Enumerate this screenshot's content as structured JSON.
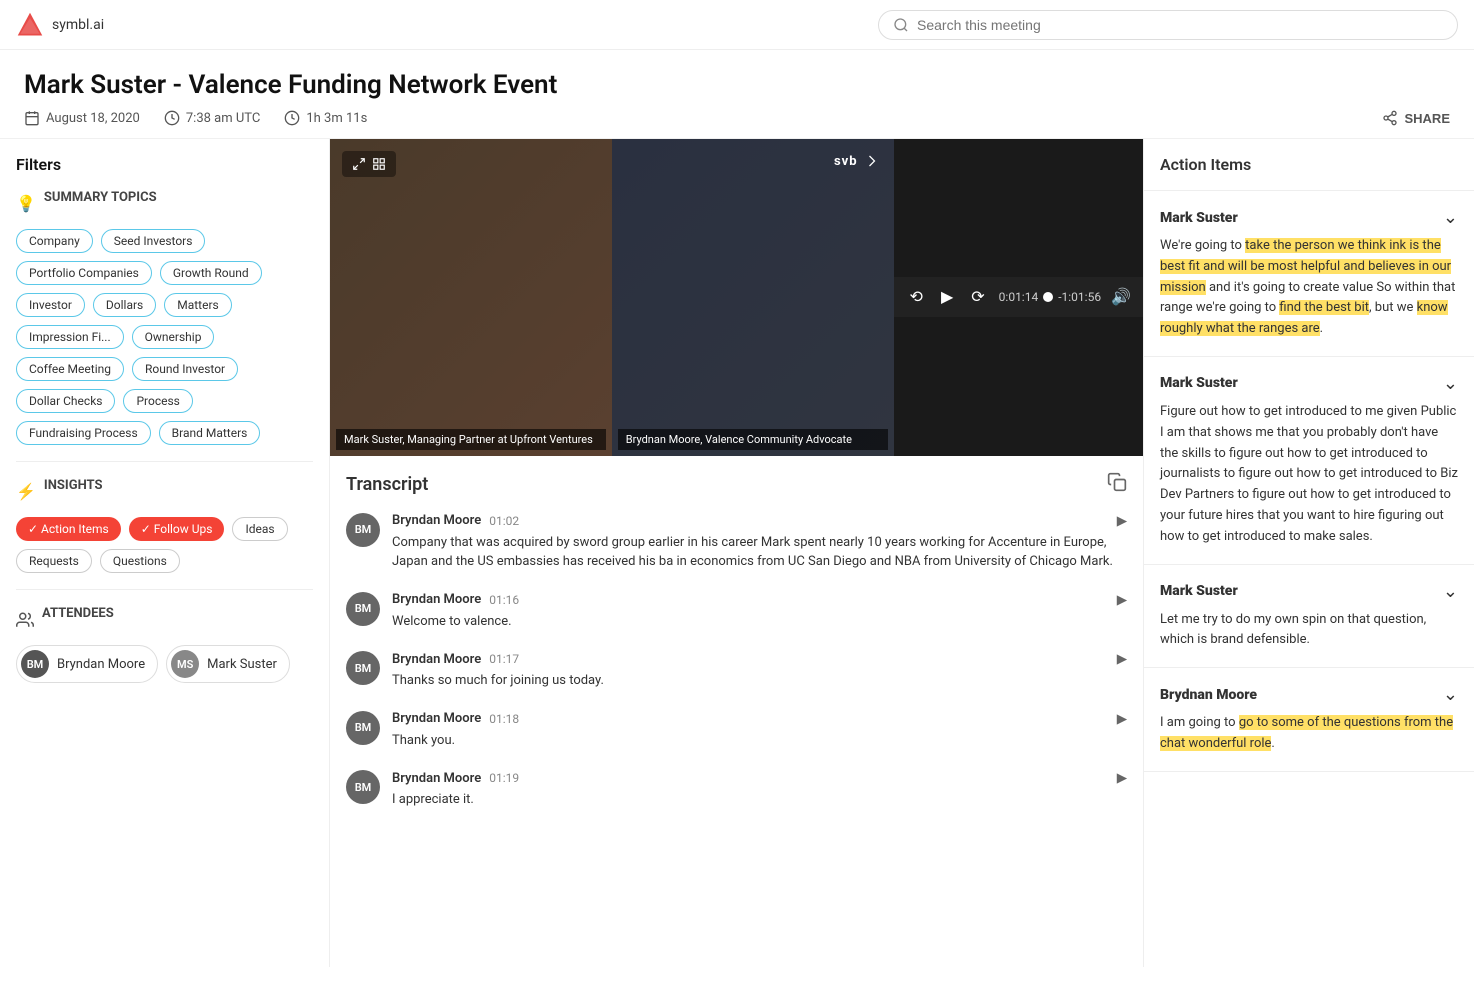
{
  "app": {
    "name": "symbl.ai"
  },
  "header": {
    "search_placeholder": "Search this meeting",
    "title": "Mark Suster - Valence Funding Network Event",
    "date": "August 18, 2020",
    "time": "7:38 am UTC",
    "duration": "1h 3m 11s",
    "share_label": "SHARE"
  },
  "filters": {
    "heading": "Filters",
    "summary_topics_label": "SUMMARY TOPICS",
    "tags": [
      "Company",
      "Seed Investors",
      "Portfolio Companies",
      "Growth Round",
      "Investor",
      "Dollars",
      "Matters",
      "Impression Fi...",
      "Ownership",
      "Coffee Meeting",
      "Round Investor",
      "Dollar Checks",
      "Process",
      "Fundraising Process",
      "Brand Matters"
    ]
  },
  "insights": {
    "label": "INSIGHTS",
    "tags": [
      {
        "label": "Action Items",
        "active": true,
        "color": "red"
      },
      {
        "label": "Follow Ups",
        "active": true,
        "color": "red"
      },
      {
        "label": "Ideas",
        "active": false
      },
      {
        "label": "Requests",
        "active": false
      },
      {
        "label": "Questions",
        "active": false
      }
    ]
  },
  "attendees": {
    "label": "ATTENDEES",
    "list": [
      {
        "initials": "BM",
        "name": "Bryndan Moore",
        "type": "bm"
      },
      {
        "initials": "MS",
        "name": "Mark Suster",
        "type": "ms"
      }
    ]
  },
  "video": {
    "left_label": "Mark Suster, Managing Partner at Upfront Ventures",
    "right_label": "Brydnan Moore, Valence Community Advocate",
    "current_time": "0:01:14",
    "remaining_time": "-1:01:56",
    "progress_percent": 1.9
  },
  "transcript": {
    "title": "Transcript",
    "items": [
      {
        "speaker": "Bryndan Moore",
        "initials": "BM",
        "time": "01:02",
        "text": "Company that was acquired by sword group earlier in his career Mark spent nearly 10 years working for Accenture in Europe, Japan and the US embassies has received his ba in economics from UC San Diego and NBA from University of Chicago Mark."
      },
      {
        "speaker": "Bryndan Moore",
        "initials": "BM",
        "time": "01:16",
        "text": "Welcome to valence."
      },
      {
        "speaker": "Bryndan Moore",
        "initials": "BM",
        "time": "01:17",
        "text": "Thanks so much for joining us today."
      },
      {
        "speaker": "Bryndan Moore",
        "initials": "BM",
        "time": "01:18",
        "text": "Thank you."
      },
      {
        "speaker": "Bryndan Moore",
        "initials": "BM",
        "time": "01:19",
        "text": "I appreciate it."
      }
    ]
  },
  "action_items": {
    "title": "Action Items",
    "items": [
      {
        "speaker": "Mark Suster",
        "text_parts": [
          {
            "text": "We're going to ",
            "highlight": false
          },
          {
            "text": "take the person we think ink is the best fit and will be most helpful and believes in our mission",
            "highlight": true
          },
          {
            "text": " and it's going to create value So within that range we're going to ",
            "highlight": false
          },
          {
            "text": "find the best bit",
            "highlight": true
          },
          {
            "text": ", but we ",
            "highlight": false
          },
          {
            "text": "know roughly what the ranges are",
            "highlight": true
          },
          {
            "text": ".",
            "highlight": false
          }
        ]
      },
      {
        "speaker": "Mark Suster",
        "text_parts": [
          {
            "text": "Figure out how to get introduced to me given Public I am that shows me that you probably don't have the skills to figure out how to get introduced to journalists to figure out how to get introduced to Biz Dev Partners to figure out how to get introduced to your future hires that you want to hire figuring out how to get introduced to make sales.",
            "highlight": false
          }
        ]
      },
      {
        "speaker": "Mark Suster",
        "text_parts": [
          {
            "text": "Let me try to do my own spin on that question, which is brand defensible.",
            "highlight": false
          }
        ]
      },
      {
        "speaker": "Brydnan Moore",
        "text_parts": [
          {
            "text": "I am going to ",
            "highlight": false
          },
          {
            "text": "go to some of the questions from the chat wonderful role",
            "highlight": true
          },
          {
            "text": ".",
            "highlight": false
          }
        ]
      }
    ]
  }
}
